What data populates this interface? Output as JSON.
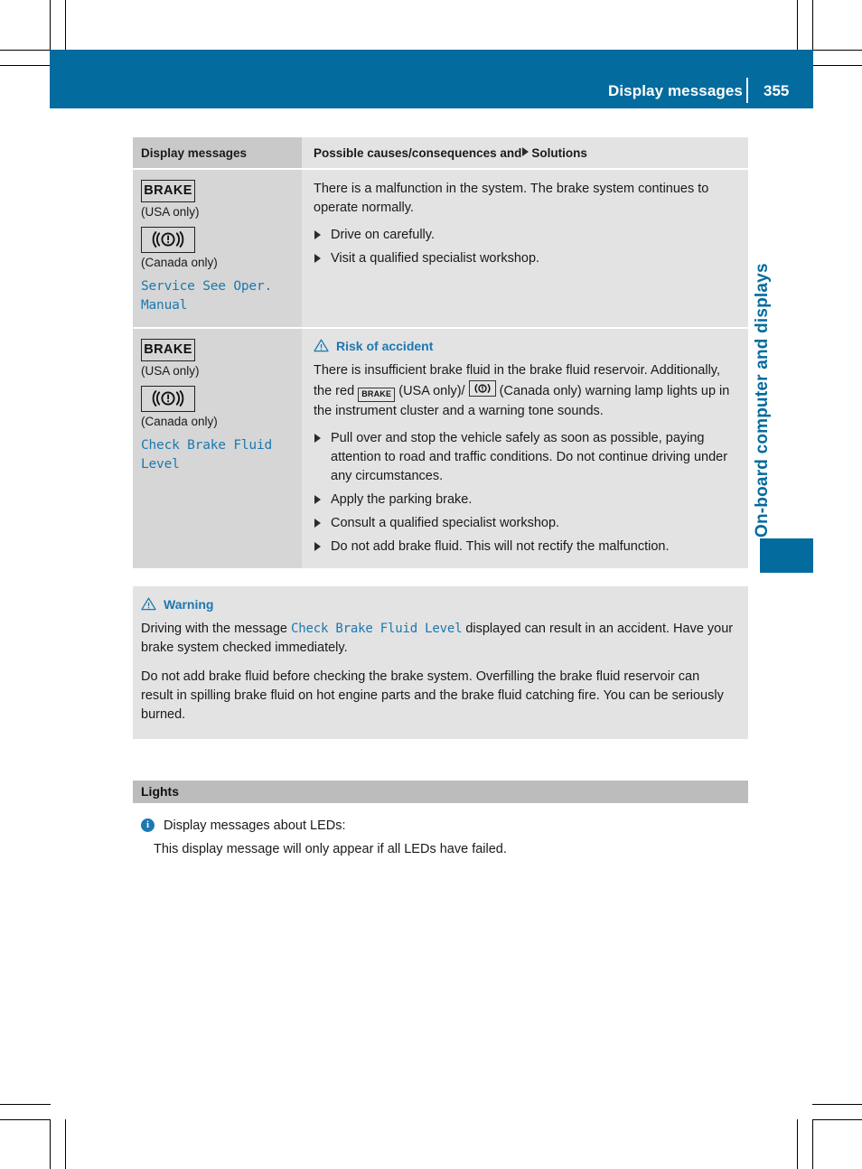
{
  "header": {
    "title": "Display messages",
    "page_number": "355"
  },
  "side_tab": {
    "label": "On-board computer and displays"
  },
  "table": {
    "headers": {
      "left": "Display messages",
      "right_before_arrow": "Possible causes/consequences and",
      "right_after_arrow": "Solutions"
    },
    "rows": [
      {
        "icons": {
          "usa_icon_label": "BRAKE",
          "usa_note": "(USA only)",
          "canada_note": "(Canada only)"
        },
        "message": "Service See Oper. Manual",
        "body_paragraph": "There is a malfunction in the system. The brake system continues to operate normally.",
        "bullets": [
          "Drive on carefully.",
          "Visit a qualified specialist workshop."
        ]
      },
      {
        "icons": {
          "usa_icon_label": "BRAKE",
          "usa_note": "(USA only)",
          "canada_note": "(Canada only)"
        },
        "message": "Check Brake Fluid Level",
        "warning_heading": "Risk of accident",
        "body_part1": "There is insufficient brake fluid in the brake fluid reservoir. Additionally, the red",
        "inline_usa_icon": "BRAKE",
        "body_part2": "(USA only)/",
        "body_part3": "(Canada only) warning lamp lights up in the instrument cluster and a warning tone sounds.",
        "bullets": [
          "Pull over and stop the vehicle safely as soon as possible, paying attention to road and traffic conditions. Do not continue driving under any circumstances.",
          "Apply the parking brake.",
          "Consult a qualified specialist workshop.",
          "Do not add brake fluid. This will not rectify the malfunction."
        ]
      }
    ]
  },
  "warning_box": {
    "heading": "Warning",
    "para1_before": "Driving with the message",
    "para1_code": "Check Brake Fluid Level",
    "para1_after": "displayed can result in an accident. Have your brake system checked immediately.",
    "para2": "Do not add brake fluid before checking the brake system. Overfilling the brake fluid reservoir can result in spilling brake fluid on hot engine parts and the brake fluid catching fire. You can be seriously burned."
  },
  "lights_section": {
    "title": "Lights",
    "info_line": "Display messages about LEDs:",
    "info_sub": "This display message will only appear if all LEDs have failed."
  },
  "colors": {
    "brand_blue": "#046b9e",
    "accent_blue": "#1b78b0",
    "table_left_bg": "#d6d6d6",
    "table_right_bg": "#e3e3e3",
    "section_bar_bg": "#bcbcbc"
  }
}
